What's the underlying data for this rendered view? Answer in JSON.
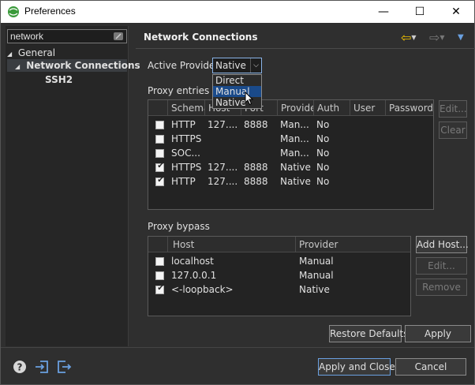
{
  "window": {
    "title": "Preferences"
  },
  "controls": {
    "minimize": "—",
    "maximize": "☐",
    "close": "✕"
  },
  "sidebar": {
    "filter_value": "network",
    "items": [
      {
        "label": "General",
        "expanded": true
      },
      {
        "label": "Network Connections",
        "expanded": true,
        "selected": true
      },
      {
        "label": "SSH2"
      }
    ]
  },
  "page": {
    "title": "Network Connections",
    "active_provider_label": "Active Provider:",
    "active_provider_value": "Native",
    "provider_options": [
      "Direct",
      "Manual",
      "Native"
    ],
    "proxy_entries_label": "Proxy entries",
    "proxy_bypass_label": "Proxy bypass"
  },
  "proxy_entries": {
    "columns": [
      "Schema",
      "Host",
      "Port",
      "Provider",
      "Auth",
      "User",
      "Password"
    ],
    "rows": [
      {
        "checked": false,
        "schema": "HTTP",
        "host": "127....",
        "port": "8888",
        "provider": "Man...",
        "auth": "No"
      },
      {
        "checked": false,
        "schema": "HTTPS",
        "host": "",
        "port": "",
        "provider": "Man...",
        "auth": "No"
      },
      {
        "checked": false,
        "schema": "SOC...",
        "host": "",
        "port": "",
        "provider": "Man...",
        "auth": "No"
      },
      {
        "checked": true,
        "schema": "HTTPS",
        "host": "127....",
        "port": "8888",
        "provider": "Native",
        "auth": "No"
      },
      {
        "checked": true,
        "schema": "HTTP",
        "host": "127....",
        "port": "8888",
        "provider": "Native",
        "auth": "No"
      }
    ],
    "edit_label": "Edit...",
    "clear_label": "Clear"
  },
  "proxy_bypass": {
    "columns": [
      "Host",
      "Provider"
    ],
    "rows": [
      {
        "checked": false,
        "host": "localhost",
        "provider": "Manual"
      },
      {
        "checked": false,
        "host": "127.0.0.1",
        "provider": "Manual"
      },
      {
        "checked": true,
        "host": "<-loopback>",
        "provider": "Native"
      }
    ],
    "add_host_label": "Add Host...",
    "edit_label": "Edit...",
    "remove_label": "Remove"
  },
  "buttons": {
    "restore_defaults": "Restore Defaults",
    "apply": "Apply",
    "apply_and_close": "Apply and Close",
    "cancel": "Cancel"
  },
  "colors": {
    "accent": "#6aa0e0",
    "back_arrow": "#f0c000",
    "selection": "#1a4a8a"
  }
}
